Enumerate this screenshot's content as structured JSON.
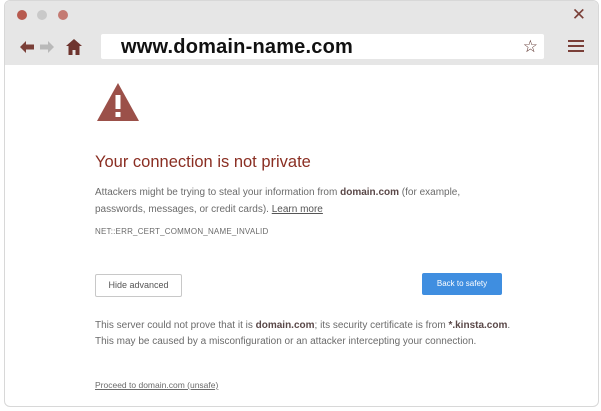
{
  "browser": {
    "window_buttons": [
      "close-dot",
      "minimize-dot",
      "maximize-dot"
    ],
    "url": "www.domain-name.com",
    "icons": {
      "back": "back-arrow-icon",
      "forward": "forward-arrow-icon",
      "home": "home-icon",
      "bookmark": "star-icon",
      "menu": "hamburger-menu-icon",
      "close": "close-icon"
    }
  },
  "page": {
    "heading": "Your connection is not private",
    "message_prefix": "Attackers might be trying to steal your information from ",
    "message_domain": "domain.com",
    "message_suffix": " (for example, passwords, messages, or credit cards). ",
    "learn_more": "Learn more",
    "error_code": "NET::ERR_CERT_COMMON_NAME_INVALID",
    "hide_advanced_label": "Hide advanced",
    "back_to_safety_label": "Back to safety",
    "advanced_prefix": "This server could not prove that it is ",
    "advanced_domain": "domain.com",
    "advanced_middle": "; its security certificate is from ",
    "advanced_cert": "*.kinsta.com",
    "advanced_suffix": ". This may be caused by a misconfiguration or an attacker intercepting your connection.",
    "proceed_link": "Proceed to domain.com (unsafe)"
  },
  "colors": {
    "heading": "#8a2e22",
    "warning_icon": "#9b5049",
    "primary_button": "#3f8ee0",
    "chrome_bar": "#e6e6e6"
  }
}
